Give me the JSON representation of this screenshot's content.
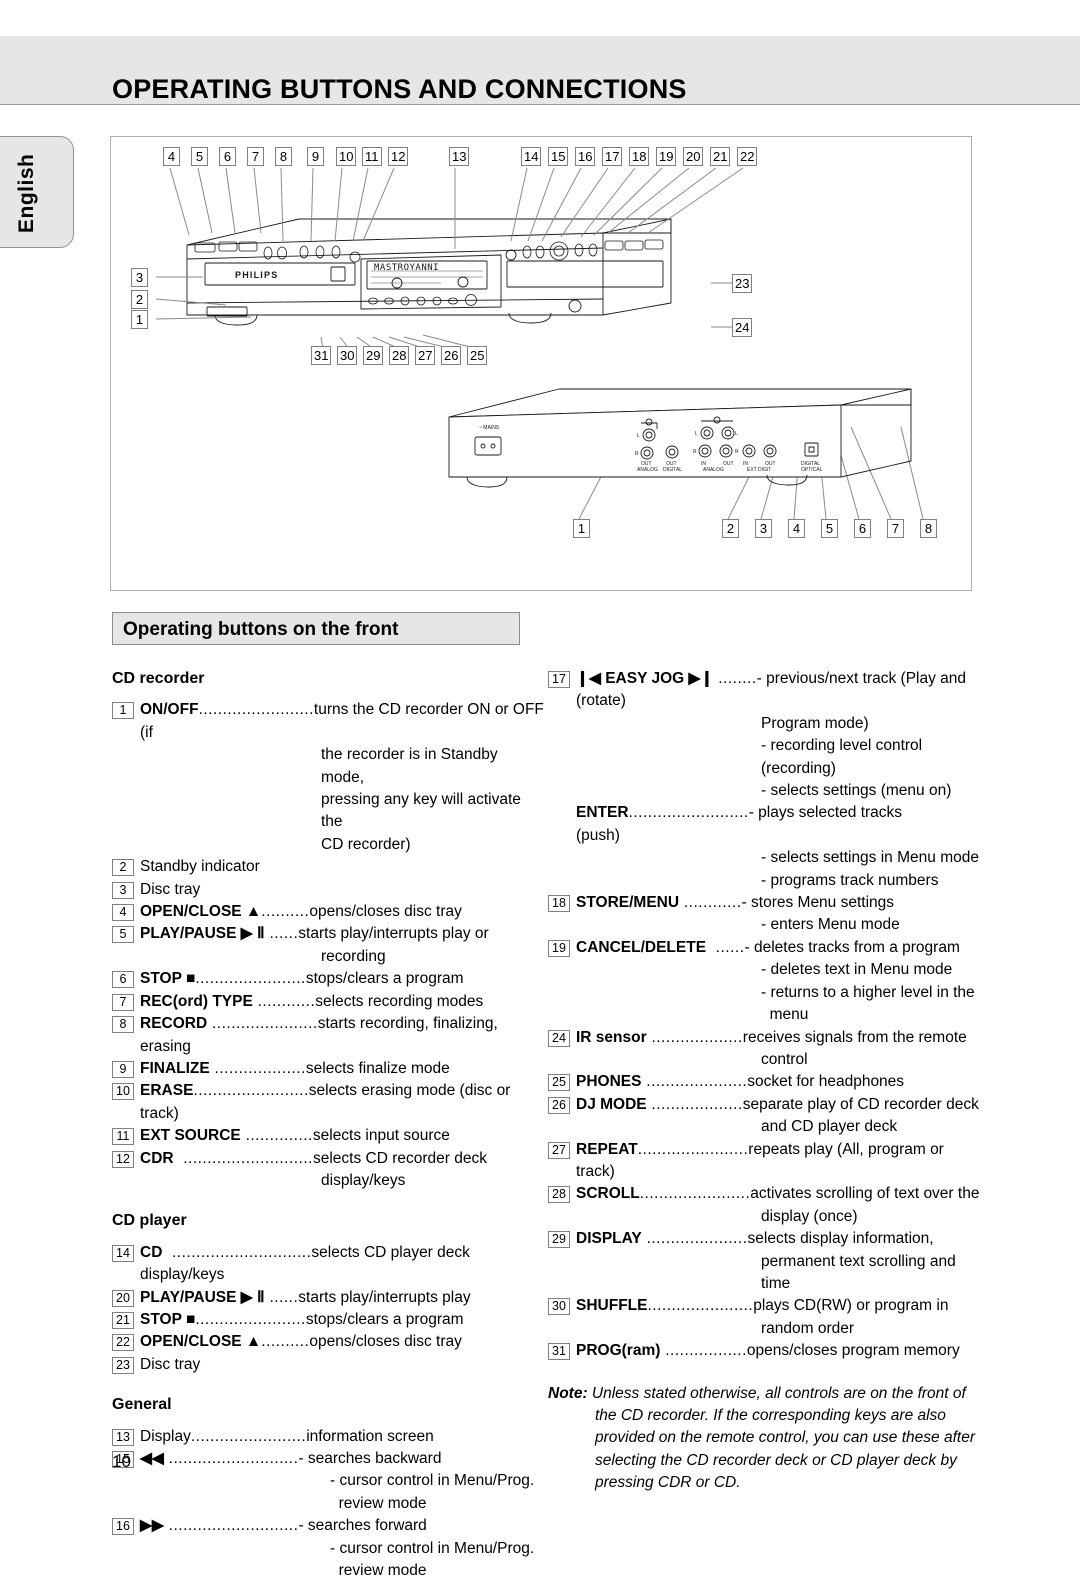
{
  "header": {
    "title": "OPERATING BUTTONS AND CONNECTIONS"
  },
  "sidebar": {
    "language_tab": "English"
  },
  "page": {
    "number": "10"
  },
  "section": {
    "title": "Operating buttons on the front"
  },
  "diagram": {
    "front_top_numbers": [
      "4",
      "5",
      "6",
      "7",
      "8",
      "9",
      "10",
      "11",
      "12",
      "13",
      "14",
      "15",
      "16",
      "17",
      "18",
      "19",
      "20",
      "21",
      "22"
    ],
    "front_left_numbers": [
      "3",
      "2",
      "1"
    ],
    "front_right_numbers": [
      "23",
      "24"
    ],
    "front_bottom_numbers": [
      "31",
      "30",
      "29",
      "28",
      "27",
      "26",
      "25"
    ],
    "rear_numbers": [
      "1",
      "2",
      "3",
      "4",
      "5",
      "6",
      "7",
      "8"
    ],
    "brand": "PHILIPS",
    "display_text": "MASTROYANNI",
    "rear_labels": {
      "mains": "~ MAINS",
      "analog_out": "OUT ANALOG",
      "digital_out": "OUT DIGITAL",
      "analog_in": "IN",
      "analog_out2": "OUT",
      "ext_in": "IN",
      "ext_out": "OUT",
      "optical": "DIGITAL OPTICAL",
      "ch_left": "L",
      "ch_right": "R"
    }
  },
  "groups": {
    "cd_recorder": "CD recorder",
    "cd_player": "CD player",
    "general": "General"
  },
  "entries_left": [
    {
      "num": "1",
      "term": "ON/OFF",
      "leader": "........................",
      "desc": "turns the CD recorder ON or OFF (if",
      "cont": [
        "the recorder is in Standby mode,",
        "pressing any key will activate the",
        "CD recorder)"
      ]
    },
    {
      "num": "2",
      "term": "",
      "plain": "Standby indicator",
      "leader": "",
      "desc": "",
      "cont": []
    },
    {
      "num": "3",
      "term": "",
      "plain": "Disc tray",
      "leader": "",
      "desc": "",
      "cont": []
    },
    {
      "num": "4",
      "term": "OPEN/CLOSE ▲",
      "leader": "..........",
      "desc": "opens/closes disc tray",
      "cont": []
    },
    {
      "num": "5",
      "term": "PLAY/PAUSE ▶ Ⅱ",
      "leader": " ......",
      "desc": "starts play/interrupts play or",
      "cont": [
        "recording"
      ]
    },
    {
      "num": "6",
      "term": "STOP ■",
      "leader": ".......................",
      "desc": "stops/clears a program",
      "cont": []
    },
    {
      "num": "7",
      "term": "REC(ord) TYPE",
      "leader": " ............",
      "desc": "selects recording modes",
      "cont": []
    },
    {
      "num": "8",
      "term": "RECORD",
      "leader": " ......................",
      "desc": "starts recording, finalizing, erasing",
      "cont": []
    },
    {
      "num": "9",
      "term": "FINALIZE",
      "leader": " ...................",
      "desc": "selects finalize mode",
      "cont": []
    },
    {
      "num": "10",
      "term": "ERASE",
      "leader": "........................",
      "desc": "selects erasing mode (disc or track)",
      "cont": []
    },
    {
      "num": "11",
      "term": "EXT SOURCE",
      "leader": " ..............",
      "desc": "selects input source",
      "cont": []
    },
    {
      "num": "12",
      "term": "CDR",
      "leader": "  ...........................",
      "desc": "selects CD recorder deck",
      "cont": [
        "display/keys"
      ]
    }
  ],
  "entries_left_player": [
    {
      "num": "14",
      "term": "CD",
      "leader": "  .............................",
      "desc": "selects CD player deck display/keys",
      "cont": []
    },
    {
      "num": "20",
      "term": "PLAY/PAUSE ▶ Ⅱ",
      "leader": " ......",
      "desc": "starts play/interrupts play",
      "cont": []
    },
    {
      "num": "21",
      "term": "STOP ■",
      "leader": ".......................",
      "desc": "stops/clears a program",
      "cont": []
    },
    {
      "num": "22",
      "term": "OPEN/CLOSE ▲",
      "leader": "..........",
      "desc": "opens/closes disc tray",
      "cont": []
    },
    {
      "num": "23",
      "term": "",
      "plain": "Disc tray",
      "leader": "",
      "desc": "",
      "cont": []
    }
  ],
  "entries_left_general": [
    {
      "num": "13",
      "term": "",
      "plain": "Display",
      "leader": "........................",
      "desc": "information screen",
      "cont": []
    },
    {
      "num": "15",
      "term": "◀◀",
      "leader": " ...........................",
      "desc": "- searches backward",
      "cont": [
        "- cursor control in Menu/Prog.",
        "  review mode"
      ]
    },
    {
      "num": "16",
      "term": "▶▶",
      "leader": " ...........................",
      "desc": "- searches forward",
      "cont": [
        "- cursor control in Menu/Prog.",
        "  review mode"
      ]
    }
  ],
  "entries_right": [
    {
      "num": "17",
      "term": "❙◀ EASY JOG ▶❙",
      "leader": " ........",
      "desc": "- previous/next track (Play and",
      "sub": "(rotate)",
      "cont": [
        "Program mode)",
        "- recording level control (recording)",
        "- selects settings (menu on)"
      ]
    },
    {
      "num": "",
      "term": "ENTER",
      "leader": ".........................",
      "desc": "- plays selected tracks",
      "sub": "(push)",
      "cont": [
        "- selects settings in Menu mode",
        "- programs track numbers"
      ]
    },
    {
      "num": "18",
      "term": "STORE/MENU",
      "leader": " ............",
      "desc": "- stores Menu settings",
      "cont": [
        "- enters Menu mode"
      ]
    },
    {
      "num": "19",
      "term": "CANCEL/DELETE",
      "leader": "  ......",
      "desc": "- deletes tracks from a program",
      "cont": [
        "- deletes text in Menu mode",
        "- returns to a higher level in the",
        "  menu"
      ]
    },
    {
      "num": "24",
      "term": "IR sensor",
      "leader": " ...................",
      "desc": "receives signals from the remote",
      "cont": [
        "control"
      ]
    },
    {
      "num": "25",
      "term": "PHONES",
      "leader": " .....................",
      "desc": "socket for headphones",
      "cont": []
    },
    {
      "num": "26",
      "term": "DJ MODE",
      "leader": " ...................",
      "desc": "separate play of CD recorder deck",
      "cont": [
        "and CD player deck"
      ]
    },
    {
      "num": "27",
      "term": "REPEAT",
      "leader": ".......................",
      "desc": "repeats play (All, program or track)",
      "cont": []
    },
    {
      "num": "28",
      "term": "SCROLL",
      "leader": ".......................",
      "desc": "activates scrolling of text over the",
      "cont": [
        "display (once)"
      ]
    },
    {
      "num": "29",
      "term": "DISPLAY",
      "leader": " .....................",
      "desc": "selects display information,",
      "cont": [
        "permanent text scrolling and time"
      ]
    },
    {
      "num": "30",
      "term": "SHUFFLE",
      "leader": "......................",
      "desc": "plays CD(RW) or program in",
      "cont": [
        "random order"
      ]
    },
    {
      "num": "31",
      "term": "PROG(ram)",
      "leader": " .................",
      "desc": "opens/closes program memory",
      "cont": []
    }
  ],
  "note": {
    "label": "Note:",
    "lines": [
      "Unless stated otherwise, all controls are on the front of",
      "the CD recorder. If the corresponding keys are also",
      "provided on the remote control, you can use these after",
      "selecting the CD recorder deck or CD player deck by",
      "pressing CDR or CD."
    ]
  }
}
